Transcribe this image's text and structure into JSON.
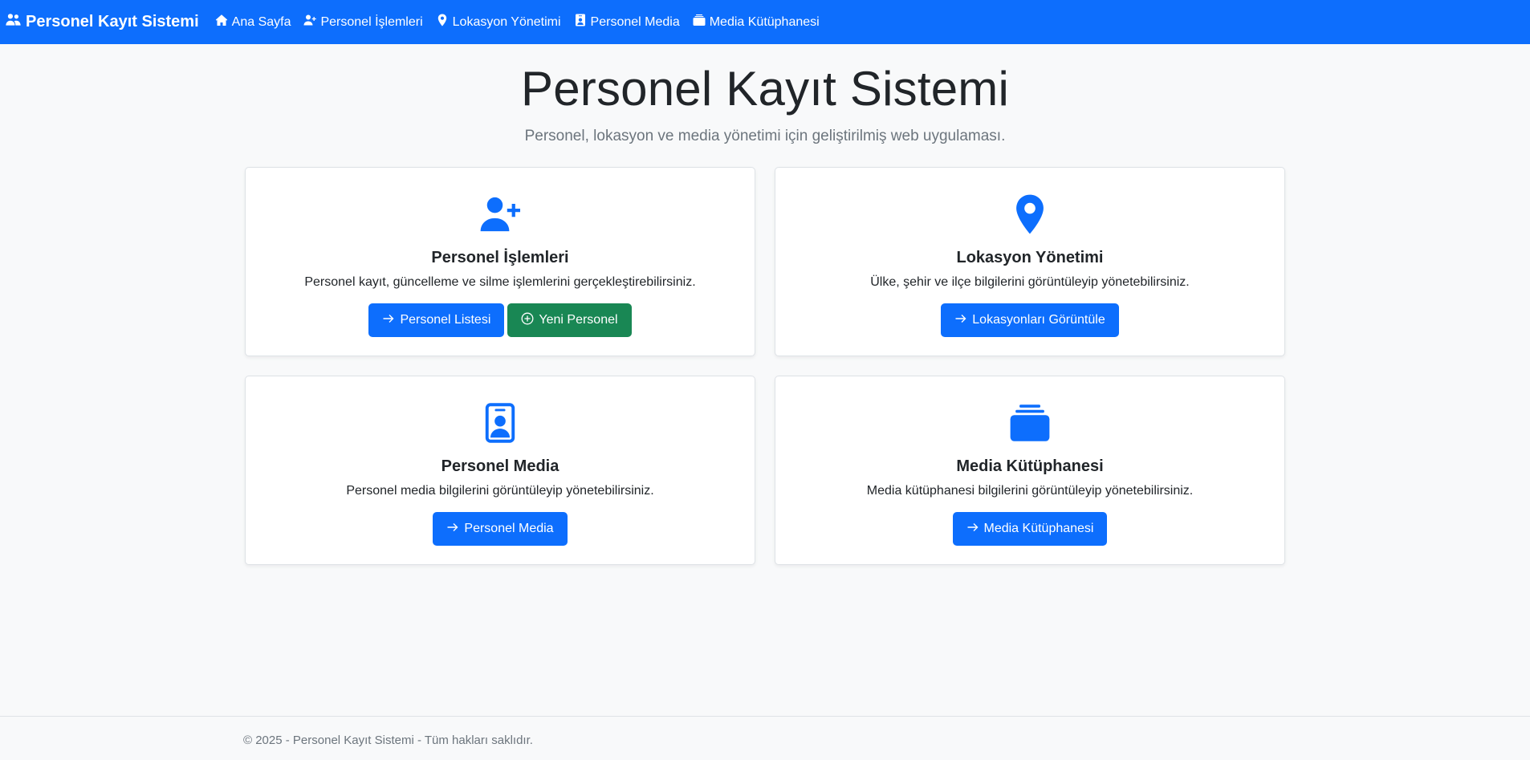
{
  "nav": {
    "brand": "Personel Kayıt Sistemi",
    "brand_icon": "people-icon",
    "items": [
      {
        "label": "Ana Sayfa",
        "icon": "house-icon"
      },
      {
        "label": "Personel İşlemleri",
        "icon": "person-plus-icon"
      },
      {
        "label": "Lokasyon Yönetimi",
        "icon": "geo-pin-icon"
      },
      {
        "label": "Personel Media",
        "icon": "person-badge-icon"
      },
      {
        "label": "Media Kütüphanesi",
        "icon": "collection-icon"
      }
    ]
  },
  "hero": {
    "title": "Personel Kayıt Sistemi",
    "subtitle": "Personel, lokasyon ve media yönetimi için geliştirilmiş web uygulaması."
  },
  "cards": [
    {
      "title": "Personel İşlemleri",
      "description": "Personel kayıt, güncelleme ve silme işlemlerini gerçekleştirebilirsiniz.",
      "icon": "person-plus-icon",
      "buttons": [
        {
          "label": "Personel Listesi",
          "icon": "arrow-right-icon",
          "style": "primary"
        },
        {
          "label": "Yeni Personel",
          "icon": "plus-circle-icon",
          "style": "success"
        }
      ]
    },
    {
      "title": "Lokasyon Yönetimi",
      "description": "Ülke, şehir ve ilçe bilgilerini görüntüleyip yönetebilirsiniz.",
      "icon": "geo-pin-icon",
      "buttons": [
        {
          "label": "Lokasyonları Görüntüle",
          "icon": "arrow-right-icon",
          "style": "primary"
        }
      ]
    },
    {
      "title": "Personel Media",
      "description": "Personel media bilgilerini görüntüleyip yönetebilirsiniz.",
      "icon": "person-badge-icon",
      "buttons": [
        {
          "label": "Personel Media",
          "icon": "arrow-right-icon",
          "style": "primary"
        }
      ]
    },
    {
      "title": "Media Kütüphanesi",
      "description": "Media kütüphanesi bilgilerini görüntüleyip yönetebilirsiniz.",
      "icon": "collection-icon",
      "buttons": [
        {
          "label": "Media Kütüphanesi",
          "icon": "arrow-right-icon",
          "style": "primary"
        }
      ]
    }
  ],
  "footer": {
    "text": "© 2025 - Personel Kayıt Sistemi - Tüm hakları saklıdır."
  },
  "colors": {
    "primary": "#0d6efd",
    "success": "#198754",
    "background": "#f8f9fa",
    "muted": "#6c757d"
  }
}
